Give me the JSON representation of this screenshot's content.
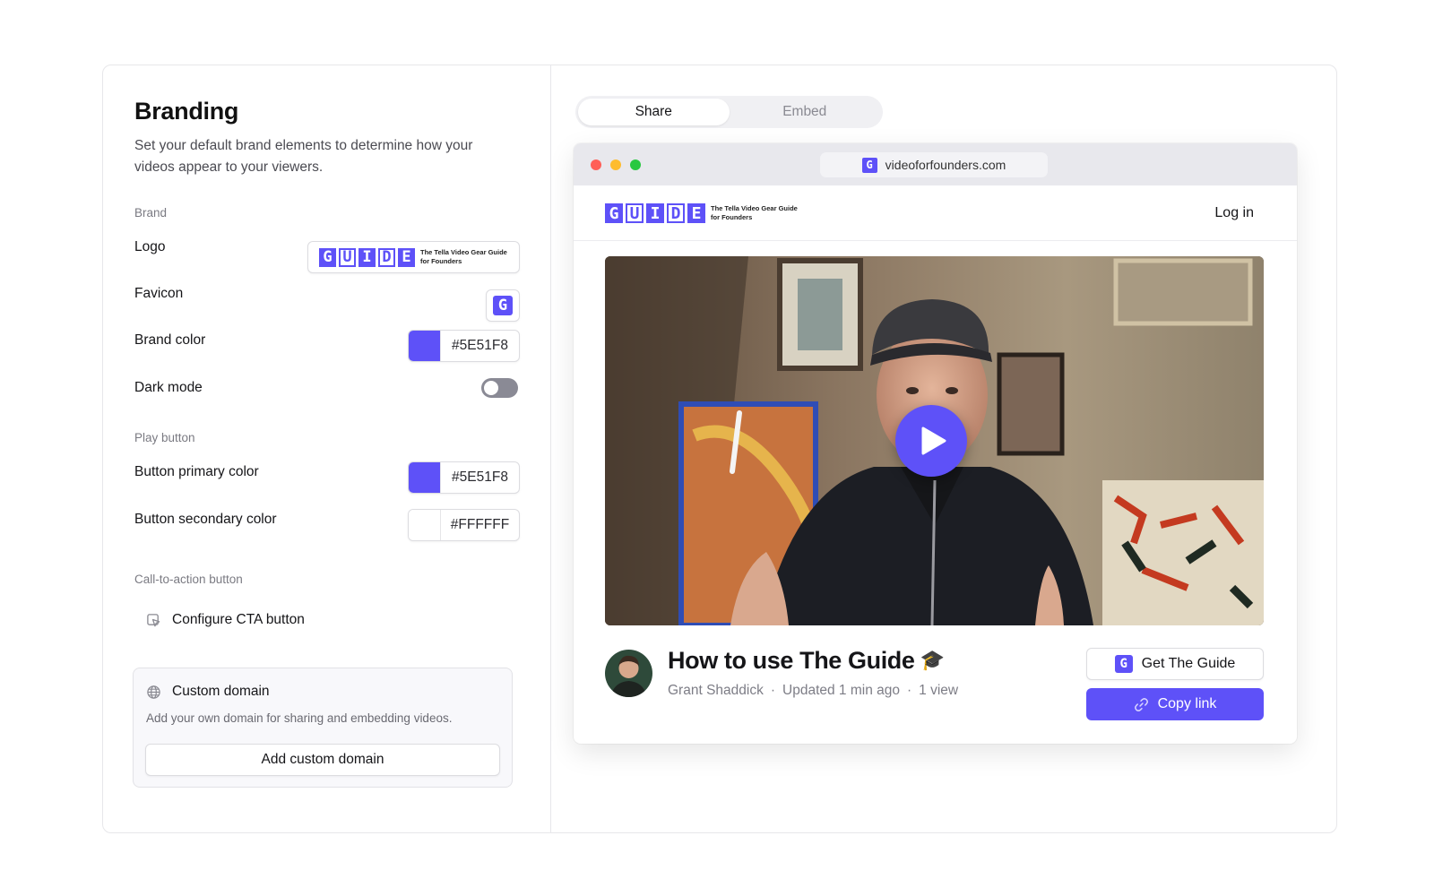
{
  "colors": {
    "brand": "#5E51F8",
    "toggle_off": "#8a8a95",
    "dot_red": "#FF5F57",
    "dot_yellow": "#FEBC2E",
    "dot_green": "#28C840"
  },
  "left": {
    "title": "Branding",
    "subtitle": "Set your default brand elements to determine how your videos appear to your viewers.",
    "brand_section": "Brand",
    "logo_label": "Logo",
    "favicon_label": "Favicon",
    "brand_color_label": "Brand color",
    "brand_color_value": "#5E51F8",
    "dark_mode_label": "Dark mode",
    "dark_mode_on": false,
    "play_section": "Play button",
    "primary_label": "Button primary color",
    "primary_value": "#5E51F8",
    "secondary_label": "Button secondary color",
    "secondary_value": "#FFFFFF",
    "cta_section": "Call-to-action button",
    "cta_label": "Configure CTA button",
    "domain_title": "Custom domain",
    "domain_desc": "Add your own domain for sharing and embedding videos.",
    "domain_button": "Add custom domain"
  },
  "logo": {
    "letters": [
      "G",
      "U",
      "I",
      "D",
      "E"
    ],
    "tagline_line1": "The Tella Video Gear Guide",
    "tagline_line2": "for Founders",
    "favicon_letter": "G"
  },
  "right": {
    "tabs": [
      {
        "label": "Share",
        "active": true
      },
      {
        "label": "Embed",
        "active": false
      }
    ],
    "url": "videoforfounders.com",
    "login": "Log in",
    "video_title": "How to use The Guide",
    "video_emoji": "🎓",
    "author": "Grant Shaddick",
    "updated": "Updated 1 min ago",
    "views": "1 view",
    "meta_separator": "·",
    "get_button": "Get The Guide",
    "copy_button": "Copy link"
  }
}
